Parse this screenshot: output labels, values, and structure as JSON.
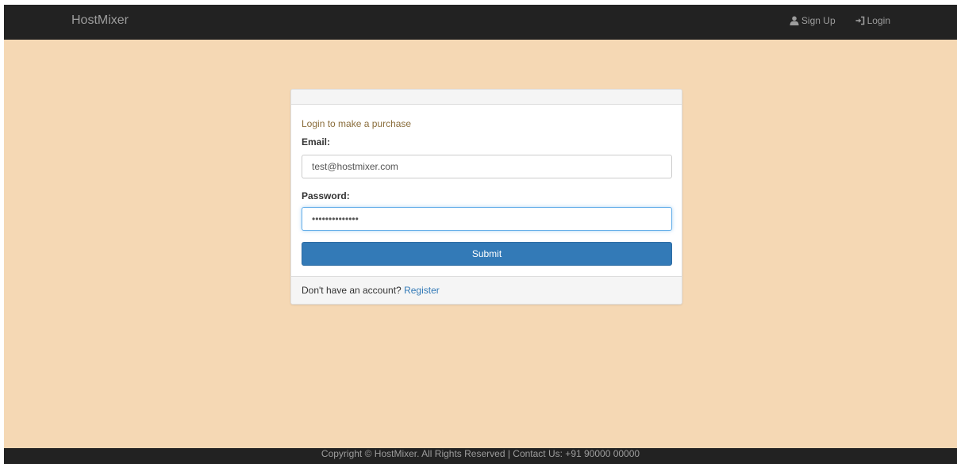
{
  "navbar": {
    "brand": "HostMixer",
    "signup": {
      "label": "Sign Up",
      "icon": "user-icon"
    },
    "login": {
      "label": "Login",
      "icon": "log-in-icon"
    }
  },
  "panel": {
    "intro": "Login to make a purchase",
    "email": {
      "label": "Email:",
      "value": "test@hostmixer.com"
    },
    "password": {
      "label": "Password:",
      "value": "••••••••••••••"
    },
    "submit_label": "Submit",
    "footer": {
      "text": "Don't have an account?",
      "link": "Register"
    }
  },
  "footer": {
    "text": "Copyright © HostMixer. All Rights Reserved | Contact Us: +91 90000 00000"
  },
  "colors": {
    "page_background": "#f5d8b4",
    "navbar": "#222222",
    "primary": "#337ab7",
    "intro_text": "#8a6d3b"
  }
}
